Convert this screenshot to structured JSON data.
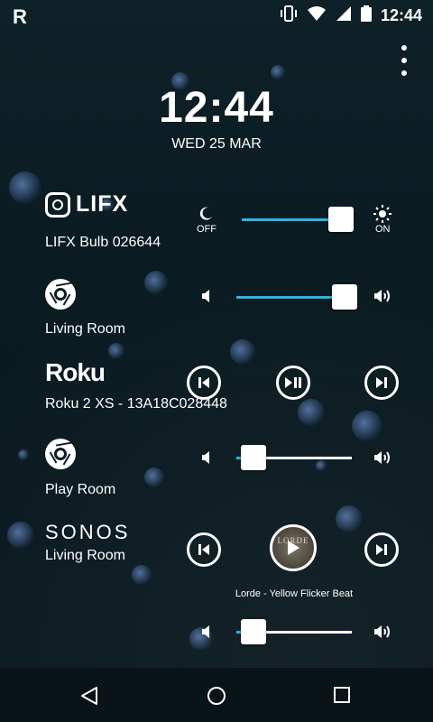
{
  "status_bar": {
    "app_glyph": "R",
    "time": "12:44",
    "icons": [
      "vibrate-icon",
      "wifi-icon",
      "signal-icon",
      "battery-icon"
    ]
  },
  "clock": {
    "time": "12:44",
    "date": "WED 25 MAR"
  },
  "devices": {
    "lifx": {
      "brand": "LIFX",
      "name": "LIFX Bulb 026644",
      "off_label": "OFF",
      "on_label": "ON",
      "brightness_percent": 90
    },
    "chromecast_living": {
      "name": "Living Room",
      "volume_percent": 90
    },
    "roku": {
      "brand": "Roku",
      "name": "Roku 2 XS - 13A18C028448"
    },
    "chromecast_play": {
      "name": "Play Room",
      "volume_percent": 10
    },
    "sonos": {
      "brand": "SONOS",
      "name": "Living Room",
      "album_art_text": "LORDE",
      "track": "Lorde - Yellow Flicker Beat",
      "volume_percent": 10
    }
  },
  "colors": {
    "accent": "#29b6e6",
    "background": "#0d1e25"
  }
}
